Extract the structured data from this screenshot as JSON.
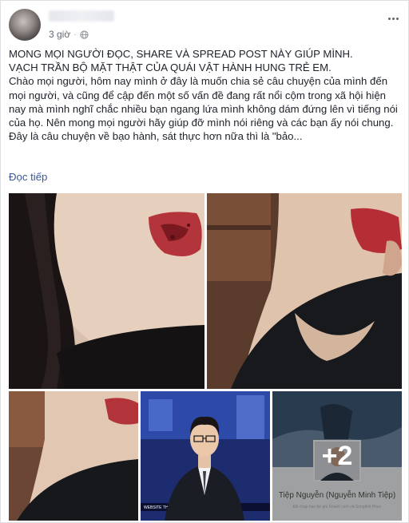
{
  "post": {
    "author": {
      "name_blurred": ""
    },
    "meta": {
      "time": "3 giờ",
      "separator": "·",
      "privacy_icon": "globe-icon"
    },
    "more_options_icon": "more-horizontal-icon",
    "text_lines": [
      "MONG MỌI NGƯỜI ĐỌC, SHARE VÀ SPREAD POST NÀY GIÚP MÌNH.",
      "VẠCH TRẦN BỘ MẶT THẬT CỦA QUÁI VẬT HÀNH HUNG TRẺ EM.",
      "Chào mọi người, hôm nay mình ở đây là muốn chia sẻ câu chuyện của mình đến mọi người, và cũng để cập đến một số vấn đề đang rất nổi cộm trong xã hội hiện nay mà mình nghĩ chắc nhiều bạn ngang lứa mình không dám đứng lên vì tiếng nói của họ. Nên mong mọi người hãy giúp đỡ mình nói riêng và các bạn ấy nói chung.",
      "Đây là câu chuyện về bạo hành, sát thực hơn nữa thì là \"bảo..."
    ],
    "read_more": "Đọc tiếp",
    "photos": {
      "extra_count": "+2",
      "last_caption_name": "Tiệp Nguyễn (Nguyễn Minh Tiệp)",
      "last_caption_sub": "Đã chụp bạn bè ghi Khanh Linh và Songlinh Phuc",
      "tv_banner": "WEBSITE THETHIEPTVVN"
    },
    "colors": {
      "link": "#385898",
      "text": "#1d2129",
      "meta": "#616770"
    }
  }
}
